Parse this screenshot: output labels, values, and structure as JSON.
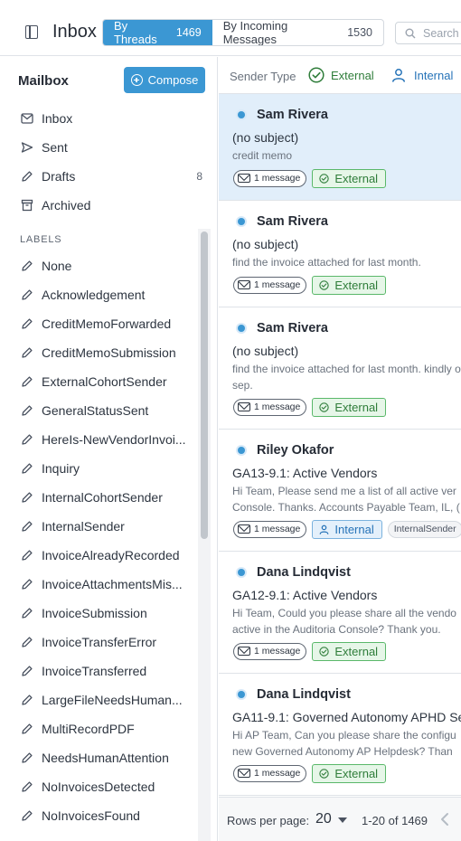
{
  "header": {
    "title": "Inbox",
    "view_tabs": [
      {
        "label": "By Threads",
        "count": "1469",
        "active": true
      },
      {
        "label": "By Incoming Messages",
        "count": "1530",
        "active": false
      }
    ],
    "search_placeholder": "Search"
  },
  "sidebar": {
    "title": "Mailbox",
    "compose_label": "Compose",
    "folders": [
      {
        "label": "Inbox",
        "icon": "inbox-icon",
        "count": ""
      },
      {
        "label": "Sent",
        "icon": "send-icon",
        "count": ""
      },
      {
        "label": "Drafts",
        "icon": "pencil-icon",
        "count": "8"
      },
      {
        "label": "Archived",
        "icon": "archive-icon",
        "count": ""
      }
    ],
    "labels_heading": "LABELS",
    "labels": [
      "None",
      "Acknowledgement",
      "CreditMemoForwarded",
      "CreditMemoSubmission",
      "ExternalCohortSender",
      "GeneralStatusSent",
      "HereIs-NewVendorInvoi...",
      "Inquiry",
      "InternalCohortSender",
      "InternalSender",
      "InvoiceAlreadyRecorded",
      "InvoiceAttachmentsMis...",
      "InvoiceSubmission",
      "InvoiceTransferError",
      "InvoiceTransferred",
      "LargeFileNeedsHuman...",
      "MultiRecordPDF",
      "NeedsHumanAttention",
      "NoInvoicesDetected",
      "NoInvoicesFound"
    ]
  },
  "filters": {
    "label": "Sender Type",
    "external": "External",
    "internal": "Internal"
  },
  "threads": [
    {
      "sender": "Sam Rivera",
      "subject": "(no subject)",
      "preview": "credit memo",
      "messages": "1 message",
      "type": "External",
      "label": "",
      "selected": true
    },
    {
      "sender": "Sam Rivera",
      "subject": "(no subject)",
      "preview": "find the invoice attached for last month.",
      "messages": "1 message",
      "type": "External",
      "label": "",
      "selected": false
    },
    {
      "sender": "Sam Rivera",
      "subject": "(no subject)",
      "preview": "find the invoice attached for last month. kindly of sep.",
      "messages": "1 message",
      "type": "External",
      "label": "",
      "selected": false
    },
    {
      "sender": "Riley Okafor",
      "subject": "GA13-9.1: Active Vendors",
      "preview": "Hi Team, Please send me a list of all active ver Console. Thanks. Accounts Payable Team, IL, (",
      "messages": "1 message",
      "type": "Internal",
      "label": "InternalSender",
      "selected": false
    },
    {
      "sender": "Dana Lindqvist",
      "subject": "GA12-9.1: Active Vendors",
      "preview": "Hi Team, Could you please share all the vendo active in the Auditoria Console? Thank you.",
      "messages": "1 message",
      "type": "External",
      "label": "",
      "selected": false
    },
    {
      "sender": "Dana Lindqvist",
      "subject": "GA11-9.1: Governed Autonomy APHD Set",
      "preview": "Hi AP Team, Can you please share the configu new Governed Autonomy AP Helpdesk? Than",
      "messages": "1 message",
      "type": "External",
      "label": "",
      "selected": false
    }
  ],
  "pagination": {
    "rows_per_page_label": "Rows per page:",
    "rows_per_page": "20",
    "range": "1-20 of 1469"
  },
  "colors": {
    "accent": "#3b97d3",
    "selected_row": "#e1eefa",
    "external_green": "#2f7d3a",
    "internal_blue": "#2673b8"
  }
}
